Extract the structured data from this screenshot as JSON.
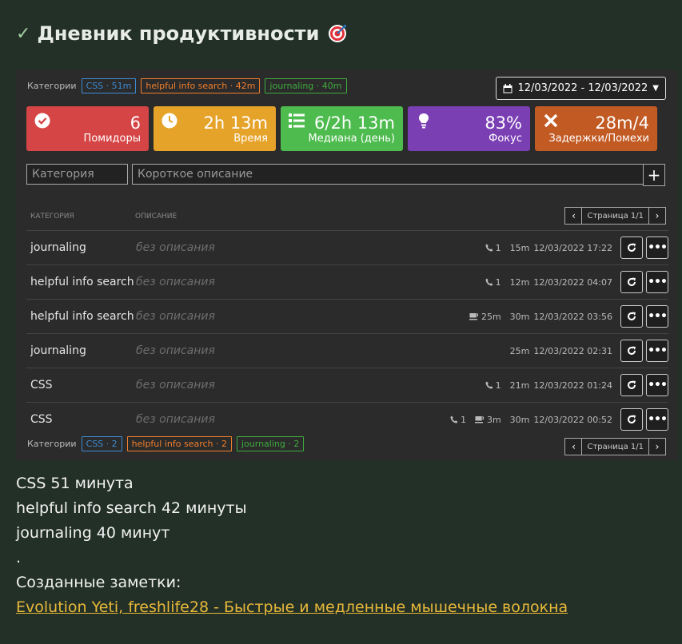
{
  "title": {
    "text": "Дневник продуктивности"
  },
  "top_categories": {
    "label": "Категории",
    "tags": [
      {
        "text": "CSS · 51m",
        "color": "#3d8bd4"
      },
      {
        "text": "helpful info search · 42m",
        "color": "#f07f2c"
      },
      {
        "text": "journaling · 40m",
        "color": "#3eab3e"
      }
    ]
  },
  "daterange": {
    "text": "12/03/2022 - 12/03/2022"
  },
  "stats": [
    {
      "value": "6",
      "caption": "Помидоры",
      "color": "#d64545",
      "icon": "check-circle-icon"
    },
    {
      "value": "2h 13m",
      "caption": "Время",
      "color": "#e6a32a",
      "icon": "clock-icon"
    },
    {
      "value": "6/2h 13m",
      "caption": "Медиана (день)",
      "color": "#4dbb4d",
      "icon": "list-icon"
    },
    {
      "value": "83%",
      "caption": "Фокус",
      "color": "#7b3fb4",
      "icon": "lightbulb-icon"
    },
    {
      "value": "28m/4",
      "caption": "Задержки/Помехи",
      "color": "#c25a24",
      "icon": "close-icon"
    }
  ],
  "inputs": {
    "category_placeholder": "Категория",
    "description_placeholder": "Короткое описание",
    "add_label": "+"
  },
  "table": {
    "col_category": "КАТЕГОРИЯ",
    "col_description": "ОПИСАНИЕ",
    "page_label": "Страница 1/1"
  },
  "rows": [
    {
      "category": "journaling",
      "description": "без описания",
      "calls": "1",
      "break": "",
      "duration": "15m",
      "datetime": "12/03/2022 17:22"
    },
    {
      "category": "helpful info search",
      "description": "без описания",
      "calls": "1",
      "break": "",
      "duration": "12m",
      "datetime": "12/03/2022 04:07"
    },
    {
      "category": "helpful info search",
      "description": "без описания",
      "calls": "",
      "break": "25m",
      "duration": "30m",
      "datetime": "12/03/2022 03:56"
    },
    {
      "category": "journaling",
      "description": "без описания",
      "calls": "",
      "break": "",
      "duration": "25m",
      "datetime": "12/03/2022 02:31"
    },
    {
      "category": "CSS",
      "description": "без описания",
      "calls": "1",
      "break": "",
      "duration": "21m",
      "datetime": "12/03/2022 01:24"
    },
    {
      "category": "CSS",
      "description": "без описания",
      "calls": "1",
      "break": "3m",
      "duration": "30m",
      "datetime": "12/03/2022 00:52"
    }
  ],
  "bottom_categories": {
    "label": "Категории",
    "tags": [
      {
        "text": "CSS · 2",
        "color": "#3d8bd4"
      },
      {
        "text": "helpful info search · 2",
        "color": "#f07f2c"
      },
      {
        "text": "journaling · 2",
        "color": "#3eab3e"
      }
    ]
  },
  "summary": {
    "line1": "CSS 51 минута",
    "line2": "helpful info search 42 минуты",
    "line3": "journaling 40 минут",
    "line4": ".",
    "line5": "Созданные заметки:",
    "link": "Evolution Yeti, freshlife28 - Быстрые и медленные мышечные волокна"
  }
}
